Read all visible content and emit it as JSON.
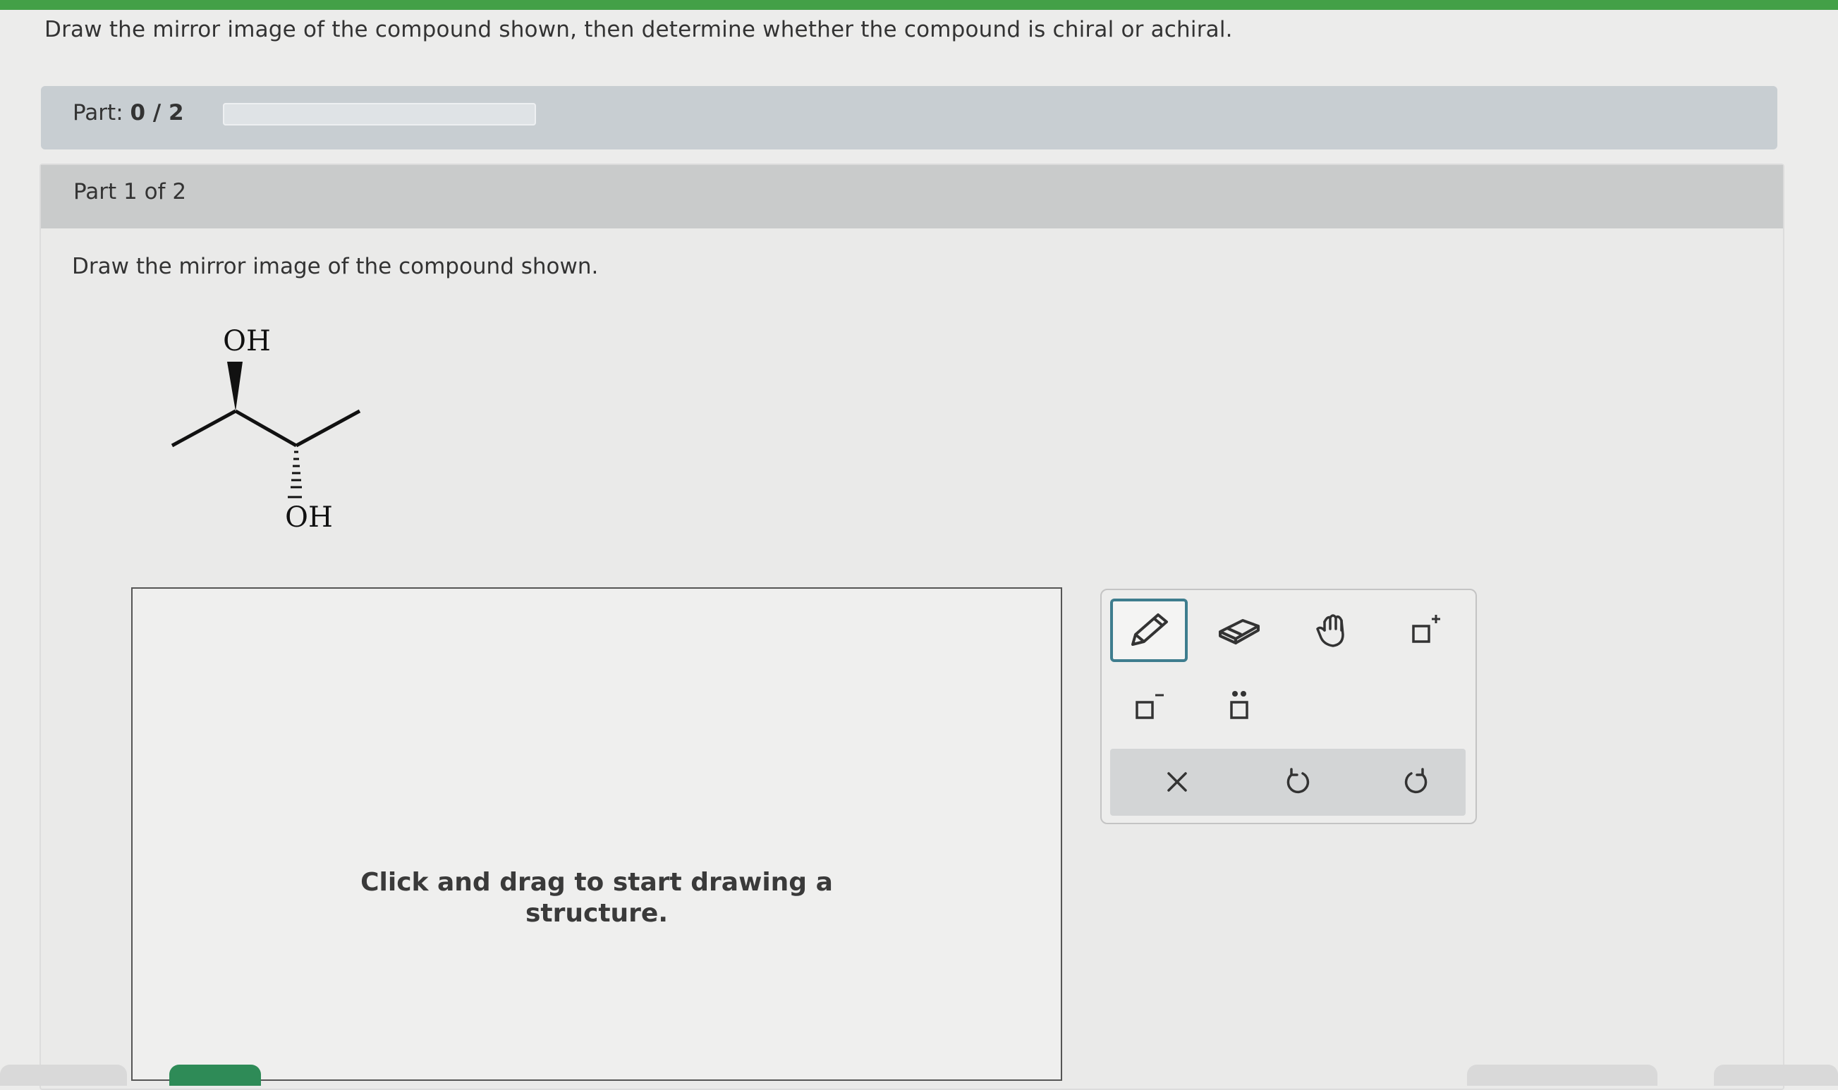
{
  "question": "Draw the mirror image of the compound shown, then determine whether the compound is chiral or achiral.",
  "progress": {
    "prefix": "Part:",
    "value": "0 / 2",
    "fraction": 0
  },
  "part": {
    "title": "Part 1 of 2",
    "instruction": "Draw the mirror image of the compound shown."
  },
  "molecule": {
    "top_label": "OH",
    "bottom_label": "OH"
  },
  "canvas": {
    "hint_line1": "Click and drag to start drawing a",
    "hint_line2": "structure."
  },
  "toolbar": {
    "tools": [
      "pencil-icon",
      "eraser-icon",
      "hand-icon",
      "positive-charge-icon",
      "negative-charge-icon",
      "lone-pair-icon"
    ],
    "actions": [
      "clear-icon",
      "undo-icon",
      "redo-icon"
    ],
    "active_tool": "pencil-icon",
    "accent": "#3e7d8e"
  },
  "colors": {
    "progress_green": "#43a047",
    "header_gray": "#c9cbcb"
  }
}
